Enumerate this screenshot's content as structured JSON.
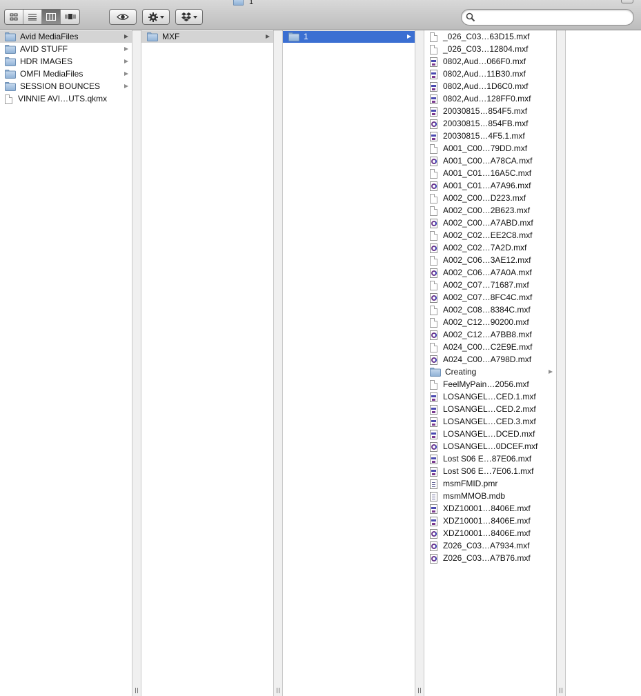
{
  "window": {
    "title": "1"
  },
  "toolbar": {
    "view_buttons": [
      "icon-view",
      "list-view",
      "column-view",
      "cover-flow-view"
    ],
    "active_view": "column-view",
    "search_placeholder": "",
    "search_value": ""
  },
  "colors": {
    "selection_blue": "#3b6fd2",
    "selection_gray": "#d4d4d4",
    "folder_blue": "#8fb1d6"
  },
  "columns": [
    {
      "items": [
        {
          "label": "Avid MediaFiles",
          "icon": "folder-icon",
          "folder": true,
          "selected": "gray"
        },
        {
          "label": "AVID STUFF",
          "icon": "folder-icon",
          "folder": true
        },
        {
          "label": "HDR IMAGES",
          "icon": "folder-icon",
          "folder": true
        },
        {
          "label": "OMFI MediaFiles",
          "icon": "folder-icon",
          "folder": true
        },
        {
          "label": "SESSION BOUNCES",
          "icon": "folder-icon",
          "folder": true
        },
        {
          "label": "VINNIE AVI…UTS.qkmx",
          "icon": "document-icon",
          "folder": false
        }
      ]
    },
    {
      "items": [
        {
          "label": "MXF",
          "icon": "folder-icon",
          "folder": true,
          "selected": "gray"
        }
      ]
    },
    {
      "items": [
        {
          "label": "1",
          "icon": "folder-icon",
          "folder": true,
          "selected": "blue"
        }
      ]
    },
    {
      "items": [
        {
          "label": "_026_C03…63D15.mxf",
          "icon": "document-icon"
        },
        {
          "label": "_026_C03…12804.mxf",
          "icon": "document-icon"
        },
        {
          "label": "0802,Aud…066F0.mxf",
          "icon": "mxf-file-icon"
        },
        {
          "label": "0802,Aud…11B30.mxf",
          "icon": "mxf-file-icon"
        },
        {
          "label": "0802,Aud…1D6C0.mxf",
          "icon": "mxf-file-icon"
        },
        {
          "label": "0802,Aud…128FF0.mxf",
          "icon": "mxf-file-icon"
        },
        {
          "label": "20030815…854F5.mxf",
          "icon": "mxf-file-icon"
        },
        {
          "label": "20030815…854FB.mxf",
          "icon": "avid-media-icon"
        },
        {
          "label": "20030815…4F5.1.mxf",
          "icon": "mxf-file-icon"
        },
        {
          "label": "A001_C00…79DD.mxf",
          "icon": "document-icon"
        },
        {
          "label": "A001_C00…A78CA.mxf",
          "icon": "avid-media-icon"
        },
        {
          "label": "A001_C01…16A5C.mxf",
          "icon": "document-icon"
        },
        {
          "label": "A001_C01…A7A96.mxf",
          "icon": "avid-media-icon"
        },
        {
          "label": "A002_C00…D223.mxf",
          "icon": "document-icon"
        },
        {
          "label": "A002_C00…2B623.mxf",
          "icon": "document-icon"
        },
        {
          "label": "A002_C00…A7ABD.mxf",
          "icon": "avid-media-icon"
        },
        {
          "label": "A002_C02…EE2C8.mxf",
          "icon": "document-icon"
        },
        {
          "label": "A002_C02…7A2D.mxf",
          "icon": "avid-media-icon"
        },
        {
          "label": "A002_C06…3AE12.mxf",
          "icon": "document-icon"
        },
        {
          "label": "A002_C06…A7A0A.mxf",
          "icon": "avid-media-icon"
        },
        {
          "label": "A002_C07…71687.mxf",
          "icon": "document-icon"
        },
        {
          "label": "A002_C07…8FC4C.mxf",
          "icon": "avid-media-icon"
        },
        {
          "label": "A002_C08…8384C.mxf",
          "icon": "document-icon"
        },
        {
          "label": "A002_C12…90200.mxf",
          "icon": "document-icon"
        },
        {
          "label": "A002_C12…A7BB8.mxf",
          "icon": "avid-media-icon"
        },
        {
          "label": "A024_C00…C2E9E.mxf",
          "icon": "document-icon"
        },
        {
          "label": "A024_C00…A798D.mxf",
          "icon": "avid-media-icon"
        },
        {
          "label": "Creating",
          "icon": "folder-icon",
          "folder": true
        },
        {
          "label": "FeelMyPain…2056.mxf",
          "icon": "document-icon"
        },
        {
          "label": "LOSANGEL…CED.1.mxf",
          "icon": "mxf-file-icon"
        },
        {
          "label": "LOSANGEL…CED.2.mxf",
          "icon": "mxf-file-icon"
        },
        {
          "label": "LOSANGEL…CED.3.mxf",
          "icon": "mxf-file-icon"
        },
        {
          "label": "LOSANGEL…DCED.mxf",
          "icon": "mxf-file-icon"
        },
        {
          "label": "LOSANGEL…0DCEF.mxf",
          "icon": "avid-media-icon"
        },
        {
          "label": "Lost S06 E…87E06.mxf",
          "icon": "mxf-file-icon"
        },
        {
          "label": "Lost S06 E…7E06.1.mxf",
          "icon": "mxf-file-icon"
        },
        {
          "label": "msmFMID.pmr",
          "icon": "database-file-icon"
        },
        {
          "label": "msmMMOB.mdb",
          "icon": "database-file-icon"
        },
        {
          "label": "XDZ10001…8406E.mxf",
          "icon": "mxf-file-icon"
        },
        {
          "label": "XDZ10001…8406E.mxf",
          "icon": "mxf-file-icon"
        },
        {
          "label": "XDZ10001…8406E.mxf",
          "icon": "avid-media-icon"
        },
        {
          "label": "Z026_C03…A7934.mxf",
          "icon": "avid-media-icon"
        },
        {
          "label": "Z026_C03…A7B76.mxf",
          "icon": "avid-media-icon"
        }
      ]
    },
    {
      "items": []
    }
  ]
}
